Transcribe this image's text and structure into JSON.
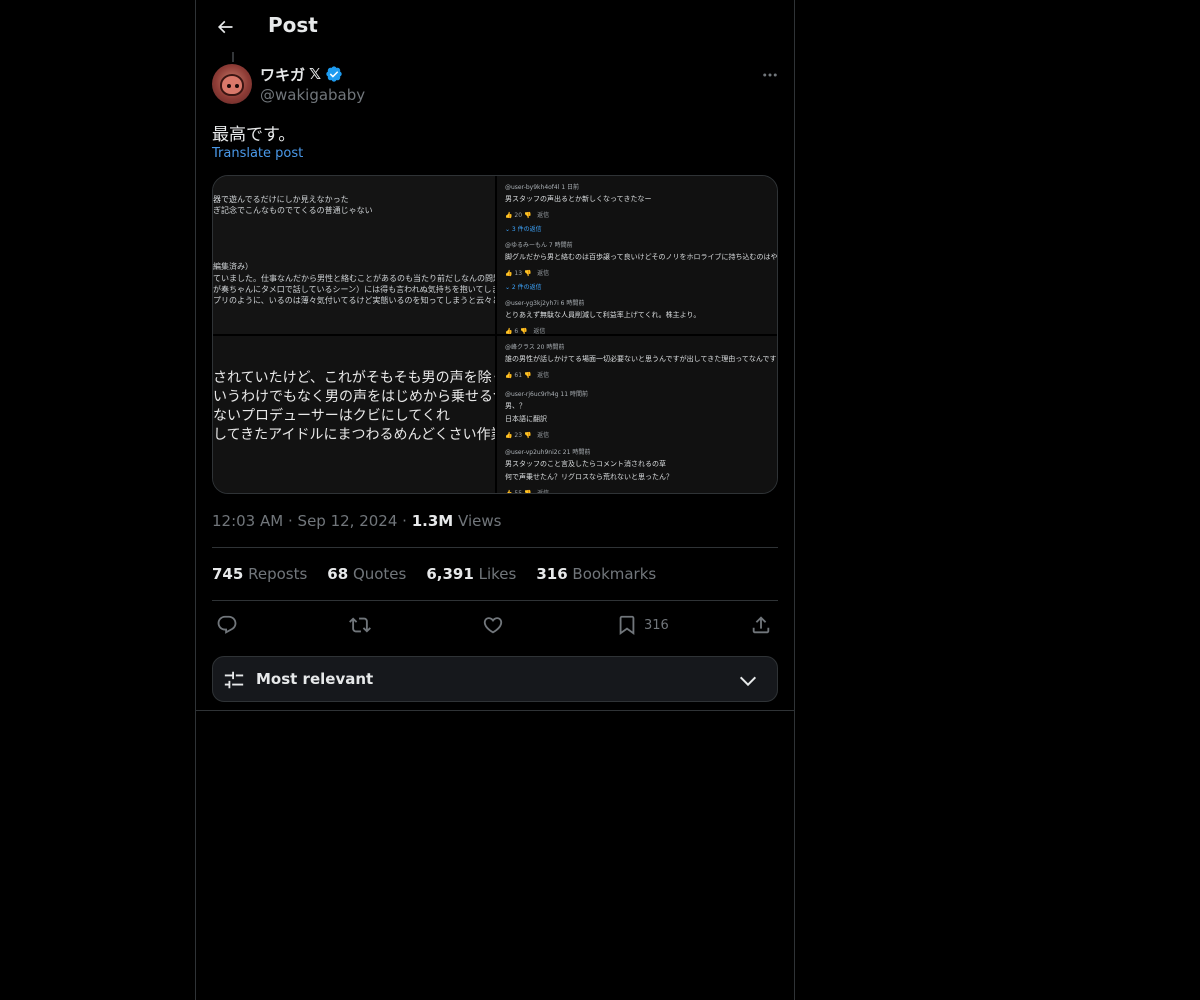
{
  "header": {
    "title": "Post"
  },
  "author": {
    "display_name": "ワキガ",
    "x_glyph": "𝕏",
    "handle": "@wakigababy"
  },
  "post": {
    "text": "最高です。",
    "translate_label": "Translate post"
  },
  "media": {
    "top_left_lines": [
      "器で遊んでるだけにしか見えなかった",
      "ぎ記念でこんなものでてくるの普通じゃない",
      "",
      "",
      "",
      "",
      "編集済み）",
      "ていました。仕事なんだから男性と絡むことがあるのも当たり前だしなんの問題もない",
      "が奏ちゃんにタメ口で話しているシーン）には得も言われぬ気持ちを抱いてしまいま",
      "プリのように、いるのは薄々気付いてるけど実態いるのを知ってしまうと云々という"
    ],
    "bottom_left_lines": [
      "されていたけど、これがそもそも男の声を除くつも",
      "いうわけでもなく男の声をはじめから乗せるつもり",
      "ないプロデューサーはクビにしてくれ",
      "してきたアイドルにまつわるめんどくさい作業をそ"
    ],
    "top_right_comments": [
      {
        "user": "@user-by9kh4of4l 1 日前",
        "text": "男スタッフの声出るとか新しくなってきたなー",
        "likes": "20",
        "reply": "返信",
        "replies": "⌄ 3 件の返信"
      },
      {
        "user": "@ゆるみーもん 7 時間前",
        "text": "脚グルだから男と絡むのは百歩譲って良いけどそのノリをホロライブに持ち込むのはやめて欲しい",
        "likes": "13",
        "reply": "返信",
        "replies": "⌄ 2 件の返信"
      },
      {
        "user": "@user-yg3kj2yh7i 6 時間前",
        "text": "とりあえず無駄な人員削減して利益率上げてくれ。株主より。",
        "likes": "6",
        "reply": "返信",
        "replies": ""
      }
    ],
    "bottom_right_comments": [
      {
        "user": "@峰クラス 20 時間前",
        "text": "誰の男性が話しかけてる場面一切必要ないと思うんですが出してきた理由ってなんですか",
        "likes": "61",
        "reply": "返信"
      },
      {
        "user": "@user-rj6uc9rh4g 11 時間前",
        "text": "男、？",
        "text2": "日本語に翻訳",
        "likes": "23",
        "reply": "返信"
      },
      {
        "user": "@user-vp2uh9ni2c 21 時間前",
        "text": "男スタッフのこと言及したらコメント消されるの草",
        "text2": "何で声乗せたん？リグロスなら荒れないと思ったん？",
        "likes": "55",
        "reply": "返信"
      }
    ]
  },
  "meta": {
    "time": "12:03 AM",
    "date": "Sep 12, 2024",
    "views_count": "1.3M",
    "views_label": "Views",
    "separator": "·"
  },
  "stats": [
    {
      "count": "745",
      "label": "Reposts"
    },
    {
      "count": "68",
      "label": "Quotes"
    },
    {
      "count": "6,391",
      "label": "Likes"
    },
    {
      "count": "316",
      "label": "Bookmarks"
    }
  ],
  "actions": {
    "bookmark_count": "316"
  },
  "sort": {
    "label": "Most relevant"
  },
  "colors": {
    "background": "#000000",
    "accent": "#1d9bf0",
    "link": "#4a99e9",
    "muted": "#71767b",
    "border": "#2f3336",
    "text": "#e7e9ea"
  },
  "icons": {
    "back": "arrow-left-icon",
    "verified": "verified-badge-icon",
    "more": "more-horizontal-icon",
    "reply": "reply-icon",
    "repost": "repost-icon",
    "like": "heart-icon",
    "bookmark": "bookmark-icon",
    "share": "share-icon",
    "sort": "sliders-icon",
    "chevron": "chevron-down-icon"
  }
}
